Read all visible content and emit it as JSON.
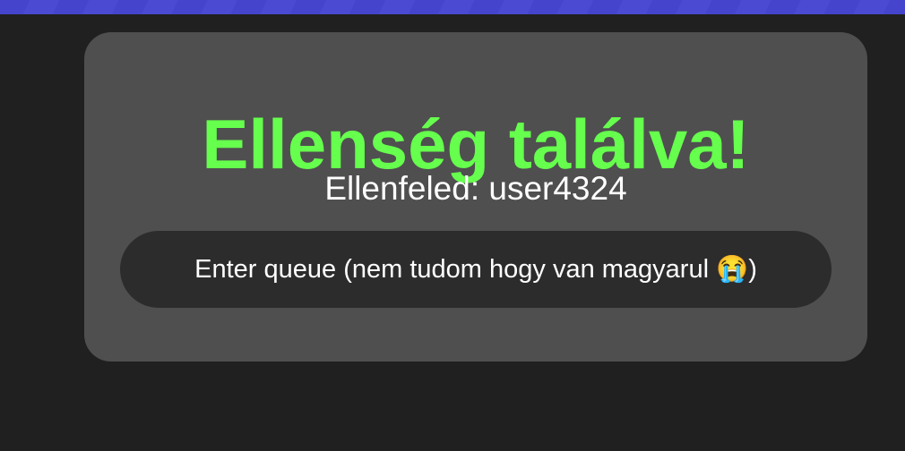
{
  "colors": {
    "page_background": "#202020",
    "top_bar": "#4444cc",
    "card_background": "#4f4f4f",
    "title": "#66ff4d",
    "button_background": "#2c2c2c",
    "text": "#ffffff"
  },
  "match": {
    "title": "Ellenség találva!",
    "opponent_label": "Ellenfeled: user4324",
    "queue_button_label": "Enter queue (nem tudom hogy van magyarul 😭)"
  }
}
